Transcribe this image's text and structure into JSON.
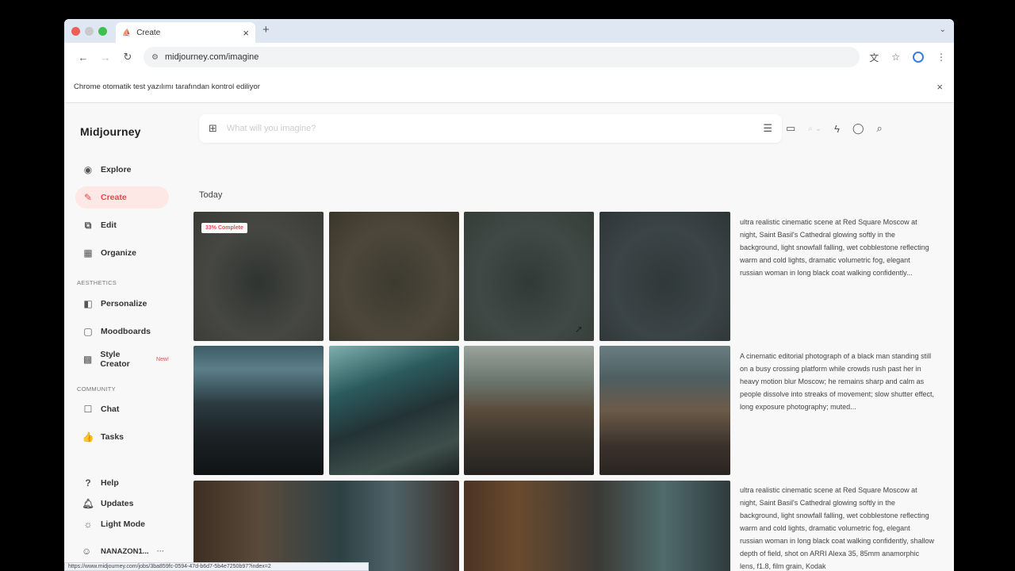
{
  "browser": {
    "tab_title": "Create",
    "url": "midjourney.com/imagine",
    "automation_notice": "Chrome otomatik test yazılımı tarafından kontrol ediliyor",
    "status_url": "https://www.midjourney.com/jobs/3ba859fc-0594-47d-b6d7-5b4e7250b97?index=2"
  },
  "sidebar": {
    "brand": "Midjourney",
    "main_items": [
      {
        "label": "Explore",
        "icon": "compass-icon"
      },
      {
        "label": "Create",
        "icon": "brush-icon"
      },
      {
        "label": "Edit",
        "icon": "edit-icon"
      },
      {
        "label": "Organize",
        "icon": "grid-icon"
      }
    ],
    "aesthetics_label": "AESTHETICS",
    "aesthetics_items": [
      {
        "label": "Personalize",
        "icon": "personalize-icon"
      },
      {
        "label": "Moodboards",
        "icon": "moodboard-icon"
      },
      {
        "label": "Style Creator",
        "icon": "style-icon",
        "badge": "New!"
      }
    ],
    "community_label": "COMMUNITY",
    "community_items": [
      {
        "label": "Chat",
        "icon": "chat-icon"
      },
      {
        "label": "Tasks",
        "icon": "thumbs-up-icon"
      }
    ],
    "footer_items": [
      {
        "label": "Help",
        "icon": "help-icon"
      },
      {
        "label": "Updates",
        "icon": "bell-icon"
      },
      {
        "label": "Light Mode",
        "icon": "sun-icon"
      }
    ],
    "user_name": "NANAZON1..."
  },
  "prompt_bar": {
    "placeholder": "What will you imagine?"
  },
  "feed": {
    "date_heading": "Today",
    "progress_badge": "33% Complete",
    "prompts": [
      "ultra realistic cinematic scene at Red Square Moscow at night, Saint Basil's Cathedral glowing softly in the background, light snowfall falling, wet cobblestone reflecting warm and cold lights, dramatic volumetric fog, elegant russian woman in long black coat walking confidently...",
      "A cinematic editorial photograph of a black man standing still on a busy crossing platform while crowds rush past her in heavy motion blur Moscow; he remains sharp and calm as people dissolve into streaks of movement; slow shutter effect, long exposure photography; muted...",
      "ultra realistic cinematic scene at Red Square Moscow at night, Saint Basil's Cathedral glowing softly in the background, light snowfall falling, wet cobblestone reflecting warm and cold lights, dramatic volumetric fog, elegant russian woman in long black coat walking confidently, shallow depth of field, shot on ARRI Alexa 35, 85mm anamorphic lens, f1.8, film grain, Kodak"
    ]
  },
  "colors": {
    "accent": "#e5484d",
    "active_bg": "#fde8e6",
    "page_bg": "#f8f8f8"
  }
}
